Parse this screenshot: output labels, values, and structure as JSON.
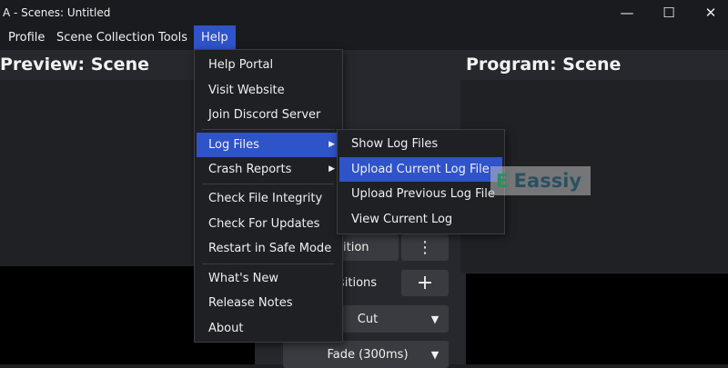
{
  "window": {
    "title": "A - Scenes: Untitled",
    "controls": {
      "minimize": "—",
      "maximize": "☐",
      "close": "✕"
    }
  },
  "menubar": {
    "items": [
      {
        "label": "Profile"
      },
      {
        "label": "Scene Collection"
      },
      {
        "label": "Tools"
      },
      {
        "label": "Help"
      }
    ]
  },
  "main": {
    "preview_title": "Preview: Scene",
    "program_title": "Program: Scene"
  },
  "transitions": {
    "quick_label": "ition",
    "transitions_label": "sitions",
    "cut_label": "Cut",
    "fade_label": "Fade (300ms)",
    "menu_glyph": "⋮",
    "add_glyph": "+",
    "arrow_glyph": "▼"
  },
  "help_menu": {
    "items": [
      {
        "label": "Help Portal"
      },
      {
        "label": "Visit Website"
      },
      {
        "label": "Join Discord Server"
      },
      {
        "label": "Log Files",
        "submenu": "▶"
      },
      {
        "label": "Crash Reports",
        "submenu": "▶"
      },
      {
        "label": "Check File Integrity"
      },
      {
        "label": "Check For Updates"
      },
      {
        "label": "Restart in Safe Mode"
      },
      {
        "label": "What's New"
      },
      {
        "label": "Release Notes"
      },
      {
        "label": "About"
      }
    ]
  },
  "log_files_menu": {
    "items": [
      {
        "label": "Show Log Files"
      },
      {
        "label": "Upload Current Log File"
      },
      {
        "label": "Upload Previous Log File"
      },
      {
        "label": "View Current Log"
      }
    ]
  },
  "watermark": {
    "icon": "E",
    "text": "Eassiy"
  },
  "colors": {
    "accent": "#2f53c8",
    "menu_bg": "#1f2024",
    "window_bg": "#1a1b1e"
  }
}
